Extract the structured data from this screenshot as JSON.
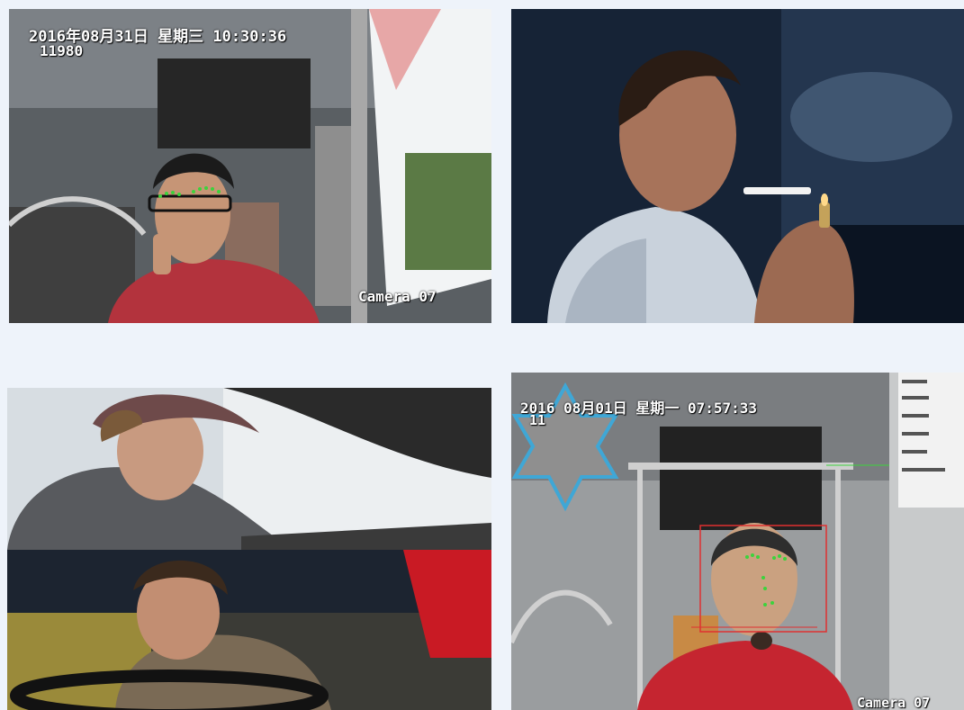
{
  "panels": [
    {
      "name": "bus-driver-phone",
      "timestamp": "2016年08月31日  星期三  10:30:36",
      "id_code": "11980",
      "camera_label": "Camera 07"
    },
    {
      "name": "driver-smoking"
    },
    {
      "name": "driver-drowsy",
      "pane_count": 2
    },
    {
      "name": "bus-driver-face-detect",
      "timestamp": "2016  08月01日  星期一  07:57:33",
      "id_code": "11",
      "camera_label": "Camera 07"
    }
  ],
  "colors": {
    "background": "#eef3fa",
    "landmark": "#3cd33c",
    "face_box": "#e03030",
    "star": "#3fa7d6",
    "overlay_text": "#ffffff"
  }
}
